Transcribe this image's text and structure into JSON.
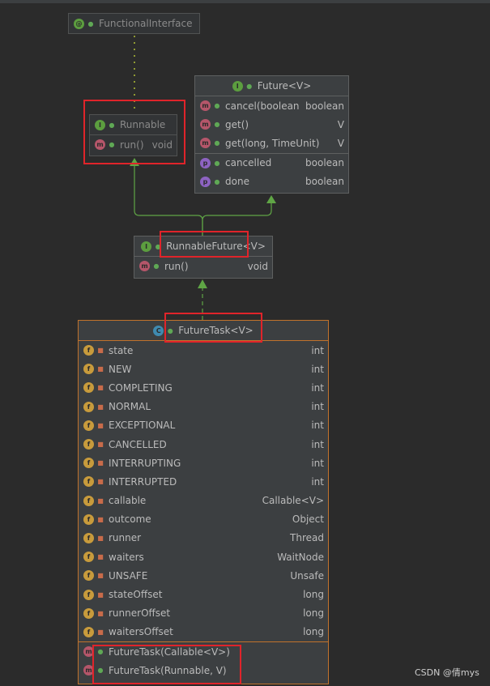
{
  "functional_interface": {
    "name": "FunctionalInterface",
    "icon": "annotation-icon"
  },
  "runnable": {
    "name": "Runnable",
    "icon": "interface-icon",
    "methods": [
      {
        "name": "run()",
        "type": "void"
      }
    ]
  },
  "future": {
    "name": "Future<V>",
    "icon": "interface-icon",
    "methods": [
      {
        "name": "cancel(boolean)",
        "type": "boolean"
      },
      {
        "name": "get()",
        "type": "V"
      },
      {
        "name": "get(long, TimeUnit)",
        "type": "V"
      }
    ],
    "properties": [
      {
        "name": "cancelled",
        "type": "boolean"
      },
      {
        "name": "done",
        "type": "boolean"
      }
    ]
  },
  "runnable_future": {
    "name": "RunnableFuture<V>",
    "icon": "interface-icon",
    "methods": [
      {
        "name": "run()",
        "type": "void"
      }
    ]
  },
  "future_task": {
    "name": "FutureTask<V>",
    "icon": "class-icon",
    "fields": [
      {
        "name": "state",
        "type": "int"
      },
      {
        "name": "NEW",
        "type": "int"
      },
      {
        "name": "COMPLETING",
        "type": "int"
      },
      {
        "name": "NORMAL",
        "type": "int"
      },
      {
        "name": "EXCEPTIONAL",
        "type": "int"
      },
      {
        "name": "CANCELLED",
        "type": "int"
      },
      {
        "name": "INTERRUPTING",
        "type": "int"
      },
      {
        "name": "INTERRUPTED",
        "type": "int"
      },
      {
        "name": "callable",
        "type": "Callable<V>"
      },
      {
        "name": "outcome",
        "type": "Object"
      },
      {
        "name": "runner",
        "type": "Thread"
      },
      {
        "name": "waiters",
        "type": "WaitNode"
      },
      {
        "name": "UNSAFE",
        "type": "Unsafe"
      },
      {
        "name": "stateOffset",
        "type": "long"
      },
      {
        "name": "runnerOffset",
        "type": "long"
      },
      {
        "name": "waitersOffset",
        "type": "long"
      }
    ],
    "constructors": [
      {
        "name": "FutureTask(Callable<V>)"
      },
      {
        "name": "FutureTask(Runnable, V)"
      }
    ]
  },
  "watermark": "CSDN @倩mys",
  "colors": {
    "background": "#2b2b2b",
    "arrow_green": "#5fa545",
    "highlight_red": "#e0242a",
    "class_border": "#c0722c"
  }
}
